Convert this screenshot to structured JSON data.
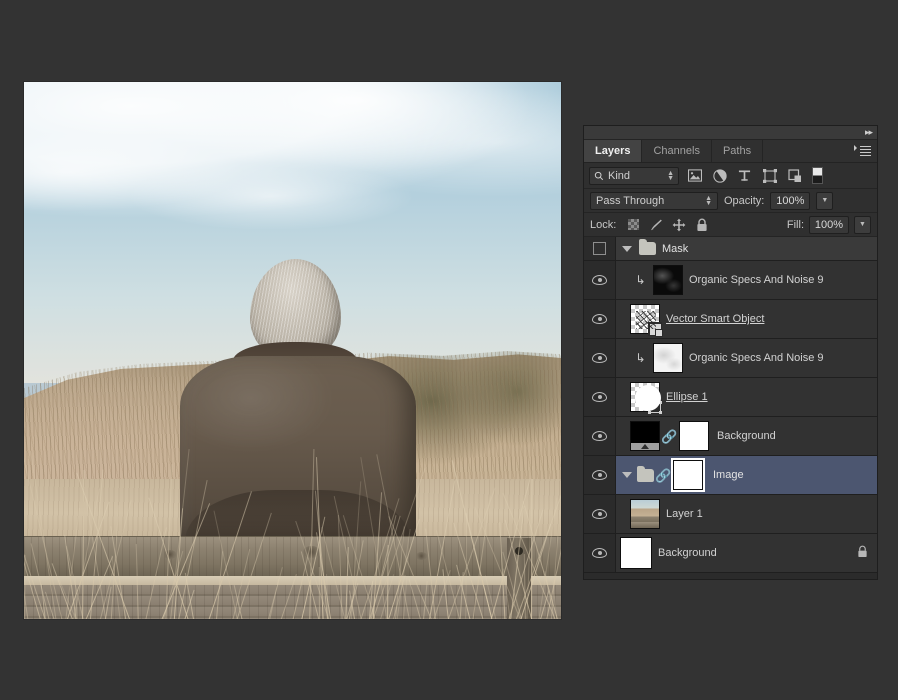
{
  "canvas": {
    "name": "photo-canvas",
    "description": "Photograph of a person with gray hair seated on a weathered wooden bench, seen from behind, facing a sand dune with dry grass under a pale blue sky"
  },
  "panel": {
    "collapse_icon": "▸▸",
    "tabs": [
      {
        "label": "Layers",
        "active": true
      },
      {
        "label": "Channels",
        "active": false
      },
      {
        "label": "Paths",
        "active": false
      }
    ],
    "filter": {
      "kind_label": "Kind",
      "search_icon": "search-icon",
      "type_icons": [
        "pixel-layer-icon",
        "adjustment-layer-icon",
        "type-layer-icon",
        "shape-layer-icon",
        "smart-object-icon",
        "swatch-toggle-icon"
      ]
    },
    "blend": {
      "mode": "Pass Through",
      "opacity_label": "Opacity:",
      "opacity_value": "100%"
    },
    "lock": {
      "label": "Lock:",
      "icons": [
        "lock-transparent-pixels-icon",
        "lock-image-pixels-icon",
        "lock-position-icon",
        "lock-all-icon"
      ],
      "fill_label": "Fill:",
      "fill_value": "100%"
    },
    "layers": [
      {
        "name": "Mask",
        "type": "group",
        "visible": false,
        "expanded": true,
        "selected": false,
        "has_checkbox": true
      },
      {
        "name": "Organic Specs And Noise 9",
        "type": "pixel",
        "visible": true,
        "selected": false,
        "clipped": true,
        "thumb": "noise-dark"
      },
      {
        "name": "Vector Smart Object",
        "type": "smart-object",
        "visible": true,
        "selected": false,
        "clipped": false,
        "underlined": true,
        "thumb": "vector-smart"
      },
      {
        "name": "Organic Specs And Noise 9",
        "type": "pixel",
        "visible": true,
        "selected": false,
        "clipped": true,
        "thumb": "noise-light"
      },
      {
        "name": "Ellipse 1",
        "type": "shape",
        "visible": true,
        "selected": false,
        "underlined": true,
        "thumb": "ellipse"
      },
      {
        "name": "Background",
        "type": "pixel-with-mask",
        "visible": true,
        "selected": false,
        "thumb": "black-gradient",
        "mask_thumb": "white",
        "linked": true
      },
      {
        "name": "Image",
        "type": "group",
        "visible": true,
        "expanded": true,
        "selected": true,
        "mask_thumb": "white",
        "linked": true
      },
      {
        "name": "Layer 1",
        "type": "pixel",
        "visible": true,
        "selected": false,
        "thumb": "photo"
      },
      {
        "name": "Background",
        "type": "pixel",
        "visible": true,
        "selected": false,
        "locked": true,
        "thumb": "white"
      }
    ]
  },
  "colors": {
    "app_background": "#333333",
    "panel_background": "#2b2b2b",
    "row_background": "#323232",
    "selected_row": "#4c5670",
    "header_background": "#3a3a3a",
    "text": "#d2d2d2"
  }
}
